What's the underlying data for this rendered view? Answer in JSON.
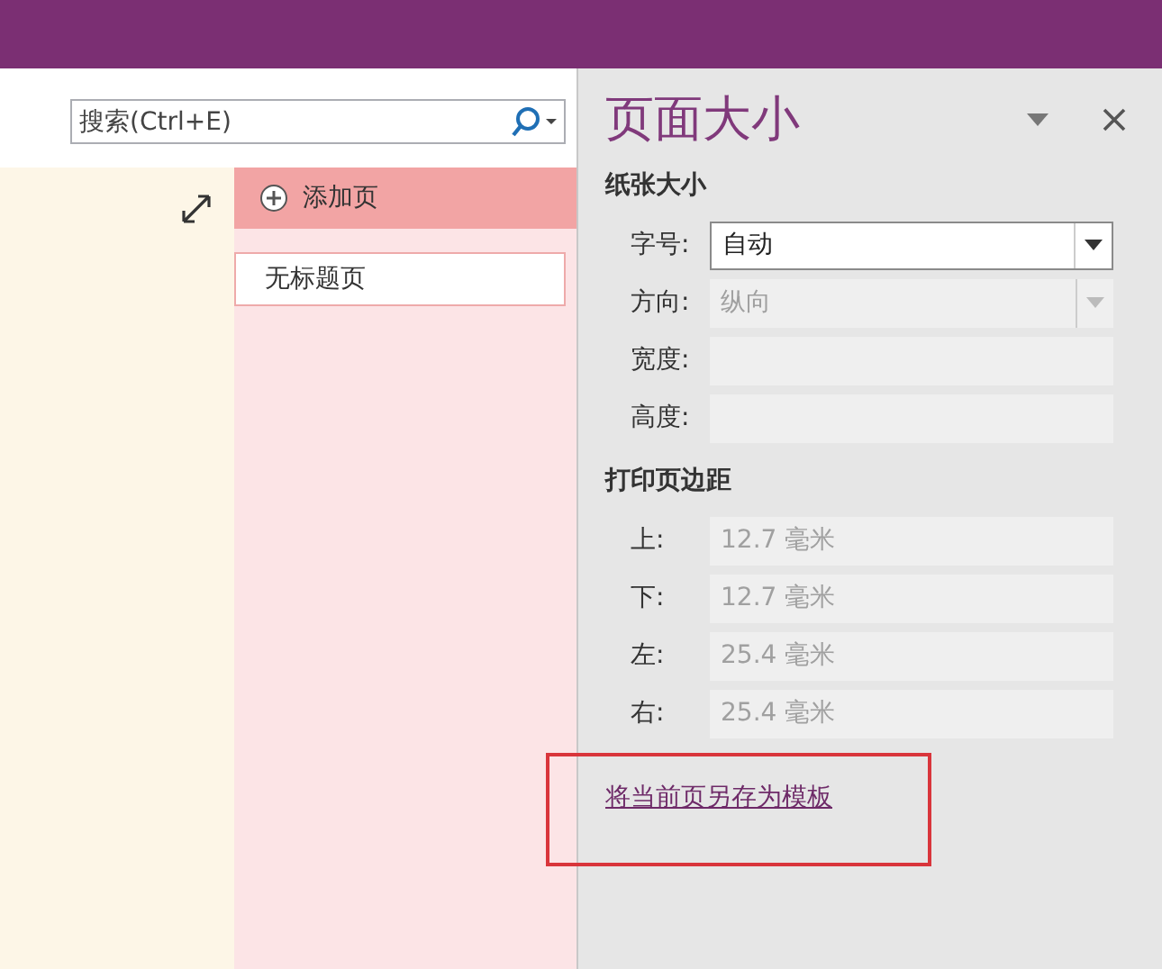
{
  "search": {
    "placeholder": "搜索(Ctrl+E)"
  },
  "page_list": {
    "add_label": "添加页",
    "pages": [
      {
        "title": "无标题页",
        "selected": true
      }
    ]
  },
  "pane": {
    "title": "页面大小",
    "sections": [
      {
        "heading": "纸张大小",
        "fields": [
          {
            "label": "字号:",
            "value": "自动",
            "kind": "dropdown",
            "disabled": false
          },
          {
            "label": "方向:",
            "value": "纵向",
            "kind": "dropdown",
            "disabled": true
          },
          {
            "label": "宽度:",
            "kind": "text",
            "disabled": true
          },
          {
            "label": "高度:",
            "kind": "text",
            "disabled": true
          }
        ]
      },
      {
        "heading": "打印页边距",
        "fields": [
          {
            "label": "上:",
            "value": "12.7 毫米",
            "kind": "text",
            "disabled": true
          },
          {
            "label": "下:",
            "value": "12.7 毫米",
            "kind": "text",
            "disabled": true
          },
          {
            "label": "左:",
            "value": "25.4 毫米",
            "kind": "text",
            "disabled": true
          },
          {
            "label": "右:",
            "value": "25.4 毫米",
            "kind": "text",
            "disabled": true
          }
        ]
      }
    ],
    "link": "将当前页另存为模板"
  }
}
